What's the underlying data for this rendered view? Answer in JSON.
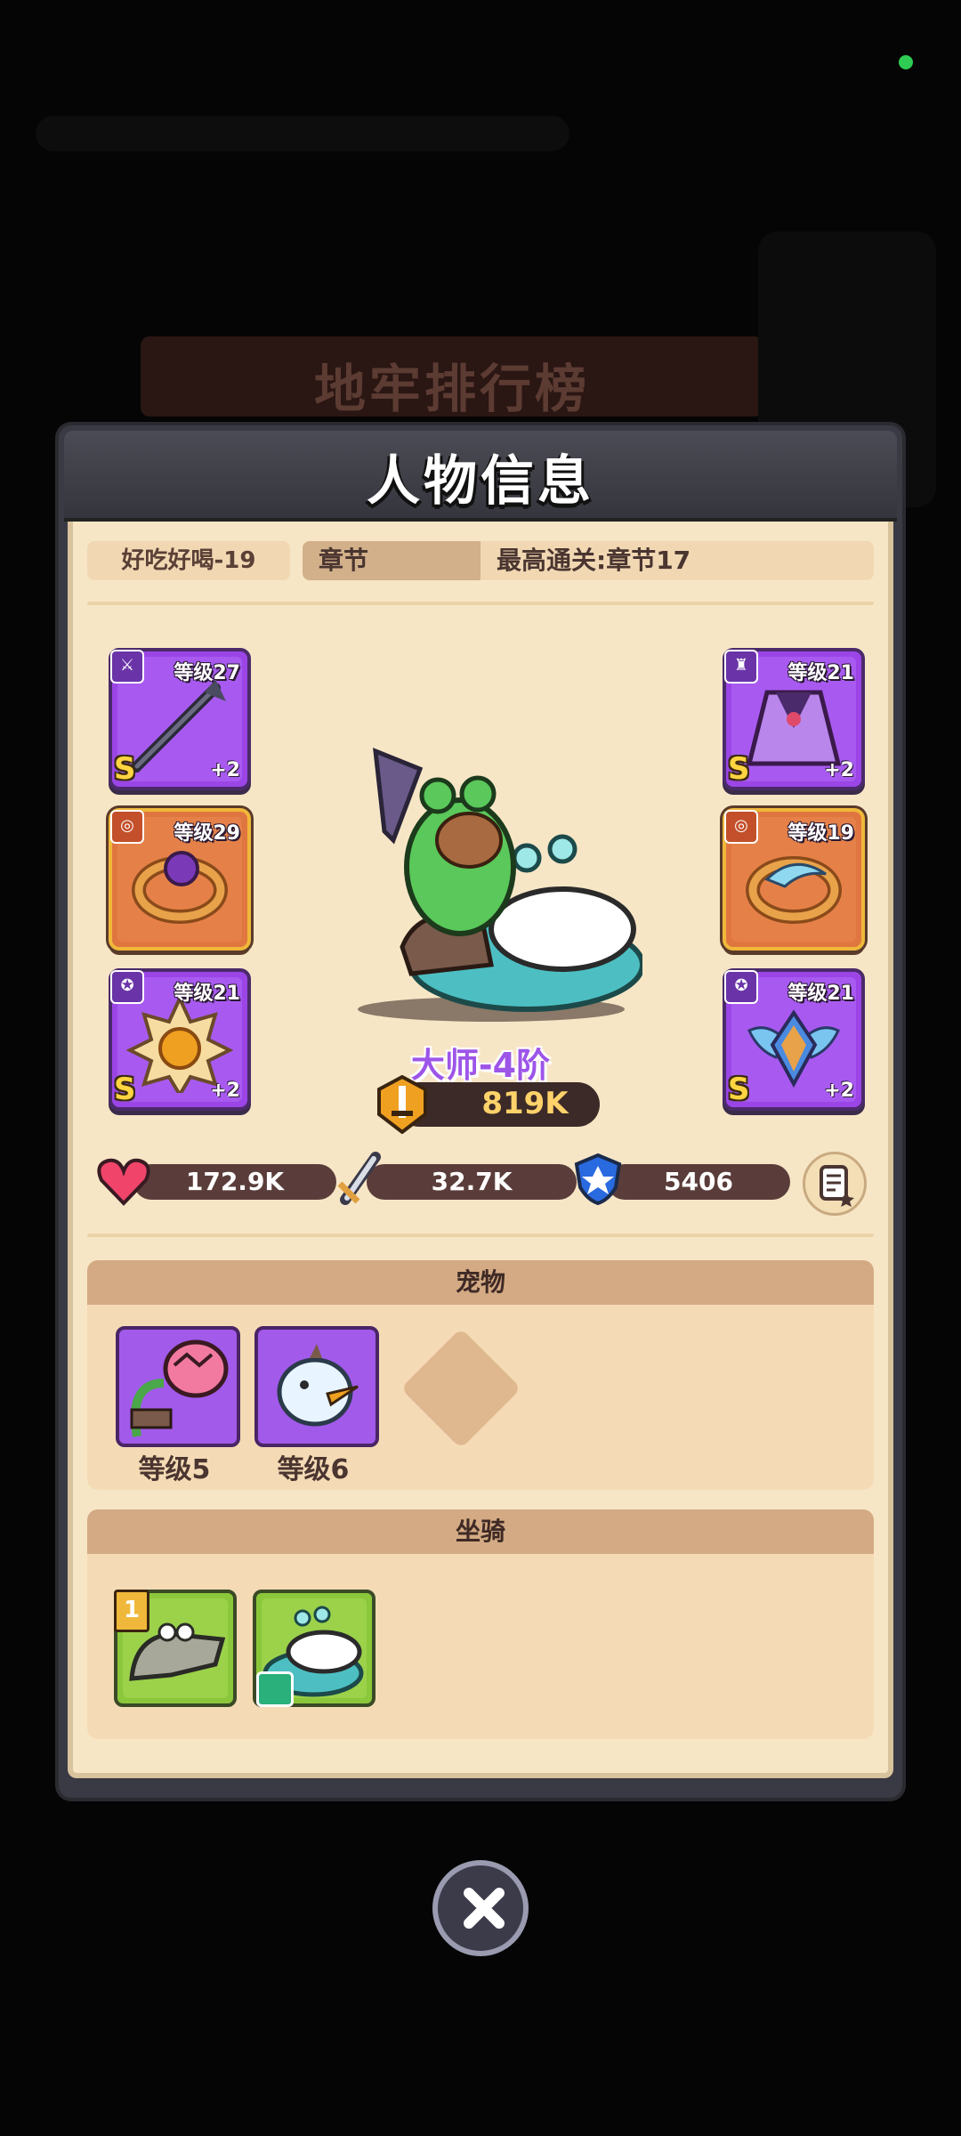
{
  "background": {
    "banner_title": "地牢排行榜"
  },
  "panel": {
    "title": "人物信息"
  },
  "player": {
    "name": "好吃好喝-19",
    "chapter_label": "章节",
    "best_clear": "最高通关:章节17"
  },
  "equipment": {
    "left": [
      {
        "slot": "weapon",
        "level_text": "等级27",
        "grade": "S",
        "plus": "+2",
        "frame": "purple"
      },
      {
        "slot": "ring",
        "level_text": "等级29",
        "grade": "",
        "plus": "",
        "frame": "orange"
      },
      {
        "slot": "medal",
        "level_text": "等级21",
        "grade": "S",
        "plus": "+2",
        "frame": "purple"
      }
    ],
    "right": [
      {
        "slot": "armor",
        "level_text": "等级21",
        "grade": "S",
        "plus": "+2",
        "frame": "purple"
      },
      {
        "slot": "ring",
        "level_text": "等级19",
        "grade": "",
        "plus": "",
        "frame": "orange"
      },
      {
        "slot": "medal",
        "level_text": "等级21",
        "grade": "S",
        "plus": "+2",
        "frame": "purple"
      }
    ]
  },
  "character": {
    "rank": "大师-4阶",
    "power": "819K"
  },
  "stats": {
    "hp": "172.9K",
    "attack": "32.7K",
    "defense": "5406"
  },
  "pets": {
    "title": "宠物",
    "items": [
      {
        "level": "等级5"
      },
      {
        "level": "等级6"
      }
    ]
  },
  "mounts": {
    "title": "坐骑",
    "badge": "1"
  },
  "colors": {
    "background": "#050505",
    "panel_body": "#f7e6c6",
    "purple_frame": "#9b45e6",
    "orange_frame": "#e0763f"
  }
}
